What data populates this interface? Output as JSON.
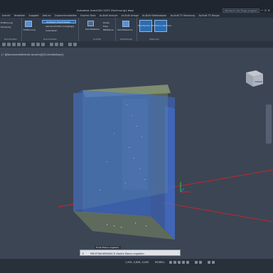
{
  "window": {
    "title": "Autodesk AutoCAD 2025   Zeichnung1.dwg",
    "search_placeholder": "Stichwort oder Frage eingeben",
    "controls": "— ☐ ✕"
  },
  "ribbon_tabs": [
    "Ansicht",
    "Verwalten",
    "Ausgabe",
    "Add-ins",
    "Zusammenarbeiten",
    "Express Tools",
    "As-Built Analyse",
    "As-Built Anlage",
    "As-Built Gebäudeplan",
    "As-Built TS Steuerung",
    "As-Built TS Design"
  ],
  "ribbon": {
    "groups": [
      {
        "title": "Koordinaten"
      },
      {
        "title": "Zuschneiden"
      },
      {
        "title": "Schnitt"
      },
      {
        "title": "Werkzeuge"
      },
      {
        "title": "Optionen"
      }
    ],
    "buttons": {
      "entfernung": "Entfernung",
      "kreuzung": "Kreuzung",
      "zuschneiden": "Anzeigen Zuschneiden",
      "alle_zuschnitte": "alle Zuschnitte rückgängig",
      "invertieren": "Invertieren",
      "schnittebene": "Schnittebene",
      "kante": "Kante",
      "ecke": "Ecke",
      "mittellinie": "Mittellinie",
      "schnittebenen_panel": "Schnittebenen",
      "punktwolken_manager": "Punktwolken Manager",
      "externe_referenz": "Externe Referenz"
    }
  },
  "viewport": {
    "label": "[−][Benutzerdefinierte Ansicht][2D-Drahtkörper]",
    "viewcube_label": "VORNE"
  },
  "command": {
    "hint": "Erste Ebene angeben:",
    "prompt": "PKEXTRAHIERANSCH Zweite Ebene angeben:"
  },
  "status": {
    "coordinates": "1,595, 0,856, 0,000",
    "mode": "MODELL"
  },
  "colors": {
    "plane_fill": "#3b6fe0",
    "axis_red": "#d12424",
    "pointcloud_edge": "#9fb08a"
  }
}
